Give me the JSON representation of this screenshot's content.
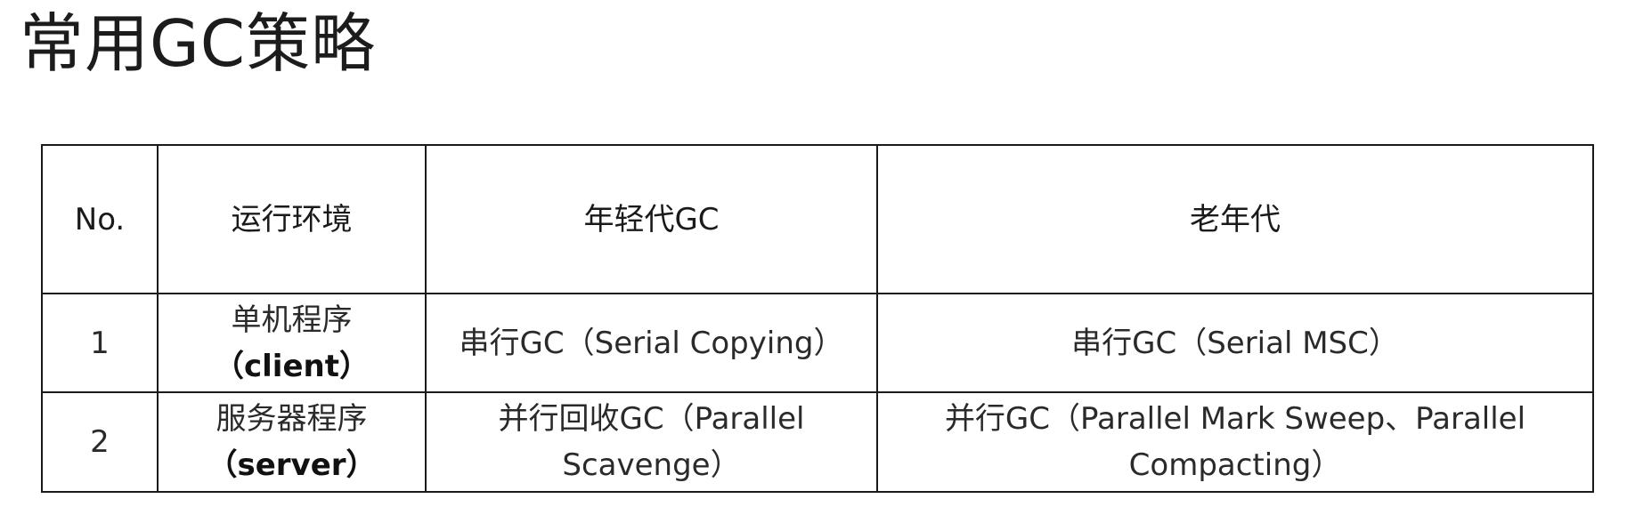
{
  "title": "常用GC策略",
  "table": {
    "headers": [
      "No.",
      "运行环境",
      "年轻代GC",
      "老年代"
    ],
    "rows": [
      {
        "no": "1",
        "env_line1": "单机程序",
        "env_line2": "（client）",
        "young_line1": "串行GC（Serial Copying）",
        "young_line2": "",
        "old_line1": "串行GC（Serial MSC）",
        "old_line2": ""
      },
      {
        "no": "2",
        "env_line1": "服务器程序",
        "env_line2": "（server）",
        "young_line1": "并行回收GC（Parallel",
        "young_line2": "Scavenge）",
        "old_line1": "并行GC（Parallel Mark Sweep、Parallel",
        "old_line2": "Compacting）"
      }
    ]
  }
}
